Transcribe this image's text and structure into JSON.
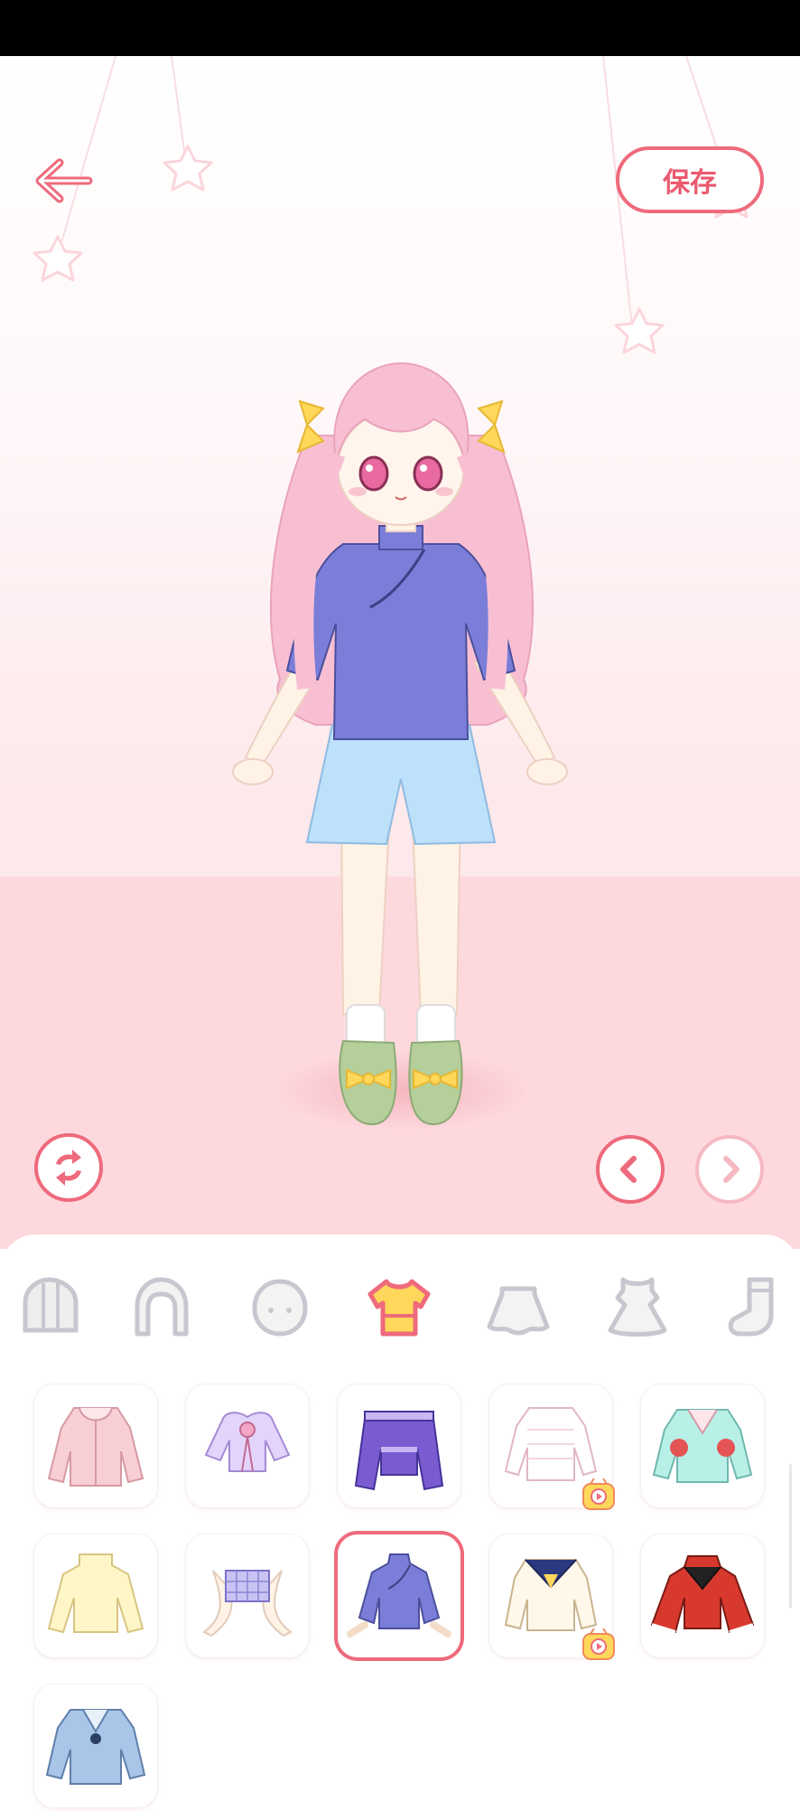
{
  "header": {
    "back_icon": "arrow-left-icon",
    "save_label": "保存"
  },
  "controls": {
    "randomize_icon": "shuffle-icon",
    "prev_icon": "chevron-left-icon",
    "next_icon": "chevron-right-icon",
    "next_enabled": false
  },
  "categories": [
    {
      "icon": "hat-icon"
    },
    {
      "icon": "hair-icon"
    },
    {
      "icon": "face-icon"
    },
    {
      "icon": "top-icon",
      "active": true
    },
    {
      "icon": "skirt-icon"
    },
    {
      "icon": "dress-icon"
    },
    {
      "icon": "sock-icon"
    }
  ],
  "items": [
    {
      "icon": "pink-hoodie-top"
    },
    {
      "icon": "lavender-ribbon-top"
    },
    {
      "icon": "purple-offshoulder-top"
    },
    {
      "icon": "white-knit-top",
      "ad": true
    },
    {
      "icon": "mint-jacket-top"
    },
    {
      "icon": "cream-sweater-top"
    },
    {
      "icon": "plaid-crop-top"
    },
    {
      "icon": "blue-qipao-top",
      "selected": true
    },
    {
      "icon": "sailor-uniform-top",
      "ad": true
    },
    {
      "icon": "red-flare-sleeve-top"
    },
    {
      "icon": "denim-top"
    }
  ],
  "colors": {
    "accent": "#ee6a7c",
    "accent_light": "#f6b9c2",
    "stage_floor": "#fdd9de"
  }
}
